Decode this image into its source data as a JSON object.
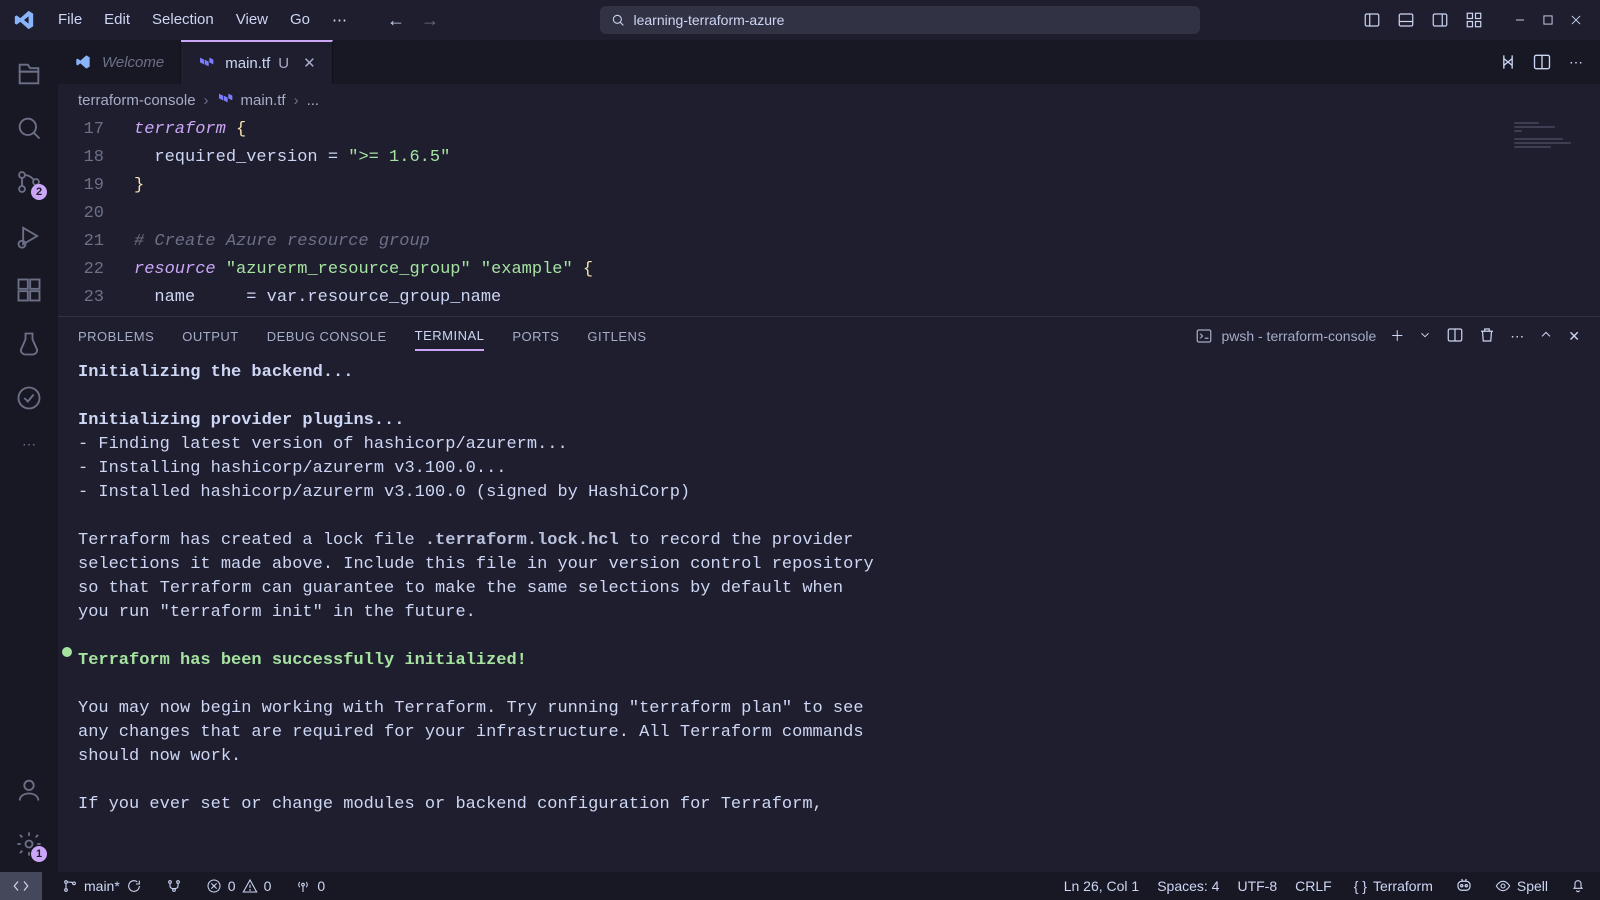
{
  "menu": {
    "file": "File",
    "edit": "Edit",
    "selection": "Selection",
    "view": "View",
    "go": "Go"
  },
  "search": {
    "text": "learning-terraform-azure"
  },
  "activity": {
    "scm_badge": "2",
    "settings_badge": "1"
  },
  "tabs": {
    "welcome": "Welcome",
    "main": "main.tf",
    "main_mod": "U"
  },
  "breadcrumbs": {
    "root": "terraform-console",
    "file": "main.tf",
    "tail": "..."
  },
  "code": {
    "lines": [
      {
        "n": "17",
        "tokens": [
          {
            "t": "terraform",
            "c": "kw"
          },
          {
            "t": " ",
            "c": ""
          },
          {
            "t": "{",
            "c": "punc"
          }
        ]
      },
      {
        "n": "18",
        "tokens": [
          {
            "t": "  required_version",
            "c": "ident"
          },
          {
            "t": " = ",
            "c": ""
          },
          {
            "t": "\">= 1.6.5\"",
            "c": "str"
          }
        ]
      },
      {
        "n": "19",
        "tokens": [
          {
            "t": "}",
            "c": "punc"
          }
        ]
      },
      {
        "n": "20",
        "tokens": []
      },
      {
        "n": "21",
        "tokens": [
          {
            "t": "# Create Azure resource group",
            "c": "cmt"
          }
        ]
      },
      {
        "n": "22",
        "tokens": [
          {
            "t": "resource",
            "c": "kw"
          },
          {
            "t": " ",
            "c": ""
          },
          {
            "t": "\"azurerm_resource_group\"",
            "c": "str"
          },
          {
            "t": " ",
            "c": ""
          },
          {
            "t": "\"example\"",
            "c": "str"
          },
          {
            "t": " ",
            "c": ""
          },
          {
            "t": "{",
            "c": "punc"
          }
        ]
      },
      {
        "n": "23",
        "tokens": [
          {
            "t": "  name     ",
            "c": "ident"
          },
          {
            "t": "= var.resource_group_name",
            "c": "ident"
          }
        ]
      }
    ]
  },
  "panel_tabs": {
    "problems": "PROBLEMS",
    "output": "OUTPUT",
    "debug": "DEBUG CONSOLE",
    "terminal": "TERMINAL",
    "ports": "PORTS",
    "gitlens": "GITLENS"
  },
  "terminal_label": "pwsh - terraform-console",
  "terminal": {
    "l1": "Initializing the backend...",
    "l2": "Initializing provider plugins...",
    "l3": "- Finding latest version of hashicorp/azurerm...",
    "l4": "- Installing hashicorp/azurerm v3.100.0...",
    "l5": "- Installed hashicorp/azurerm v3.100.0 (signed by HashiCorp)",
    "l6a": "Terraform has created a lock file ",
    "l6lock": ".terraform.lock.hcl",
    "l6b": " to record the provider",
    "l7": "selections it made above. Include this file in your version control repository",
    "l8": "so that Terraform can guarantee to make the same selections by default when",
    "l9": "you run \"terraform init\" in the future.",
    "l10": "Terraform has been successfully initialized!",
    "l11": "You may now begin working with Terraform. Try running \"terraform plan\" to see",
    "l12": "any changes that are required for your infrastructure. All Terraform commands",
    "l13": "should now work.",
    "l14": "If you ever set or change modules or backend configuration for Terraform,"
  },
  "status": {
    "branch": "main*",
    "errors": "0",
    "warnings": "0",
    "ports": "0",
    "pos": "Ln 26, Col 1",
    "spaces": "Spaces: 4",
    "enc": "UTF-8",
    "eol": "CRLF",
    "lang": "Terraform",
    "spell": "Spell"
  }
}
